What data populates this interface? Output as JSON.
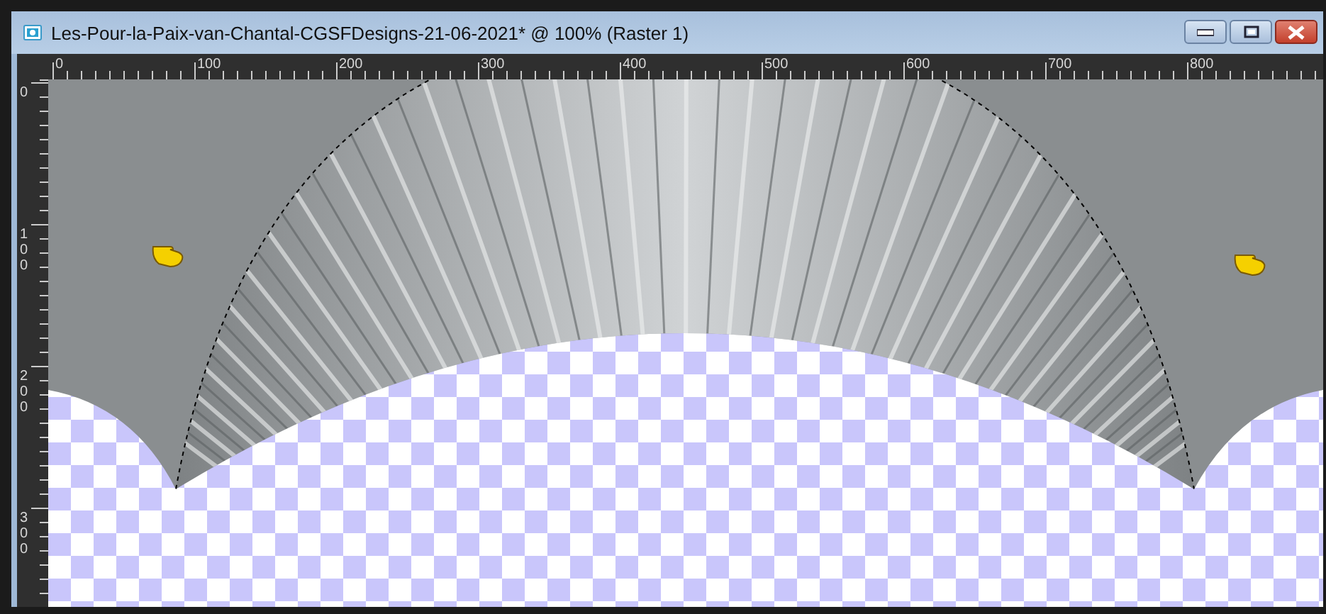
{
  "window": {
    "title": "Les-Pour-la-Paix-van-Chantal-CGSFDesigns-21-06-2021* @ 100% (Raster 1)"
  },
  "ruler_top": {
    "labels": [
      "0",
      "100",
      "200",
      "300",
      "400",
      "500",
      "600",
      "700",
      "800"
    ]
  },
  "ruler_left": {
    "labels": [
      "0",
      "100",
      "200",
      "300"
    ]
  }
}
